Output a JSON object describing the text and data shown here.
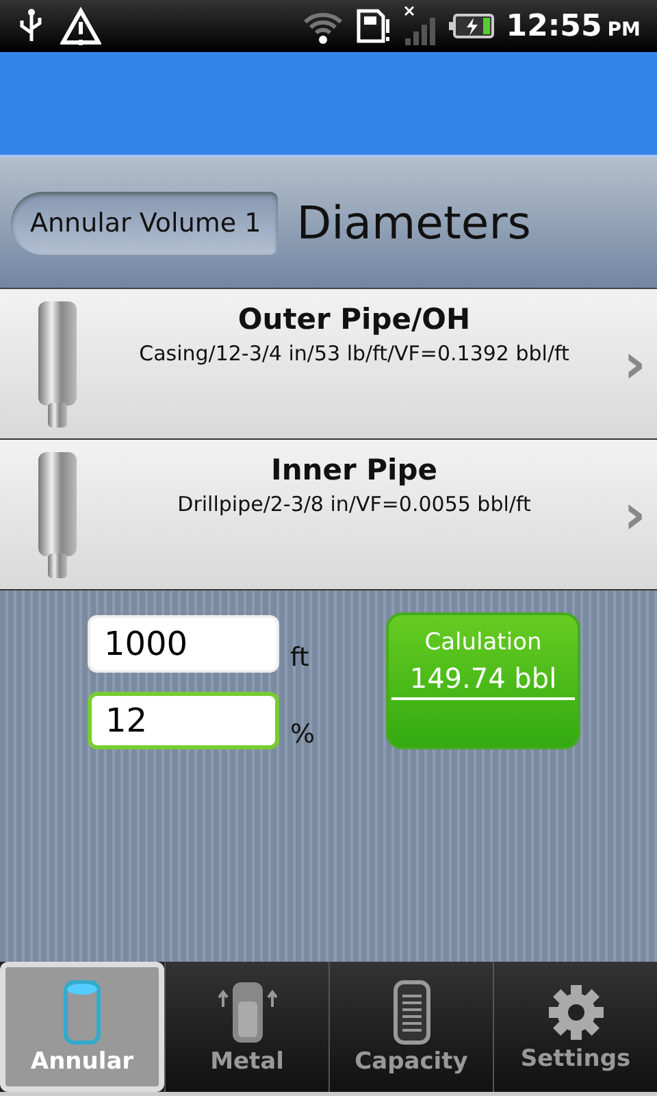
{
  "status_bar": {
    "time": "12:55",
    "meridiem": "PM"
  },
  "header": {
    "back_button": "Annular Volume 1",
    "title": "Diameters"
  },
  "pipes": [
    {
      "title": "Outer Pipe/OH",
      "detail": "Casing/12-3/4 in/53 lb/ft/VF=0.1392 bbl/ft",
      "chevron": "›"
    },
    {
      "title": "Inner Pipe",
      "detail": "Drillpipe/2-3/8 in/VF=0.0055 bbl/ft",
      "chevron": "›"
    }
  ],
  "inputs": [
    {
      "value": "1000",
      "unit": "ft",
      "focused": false
    },
    {
      "value": "12",
      "unit": "%",
      "focused": true
    }
  ],
  "result": {
    "label": "Calulation",
    "value": "149.74 bbl"
  },
  "tabs": [
    {
      "label": "Annular",
      "selected": true
    },
    {
      "label": "Metal",
      "selected": false
    },
    {
      "label": "Capacity",
      "selected": false
    },
    {
      "label": "Settings",
      "selected": false
    }
  ]
}
